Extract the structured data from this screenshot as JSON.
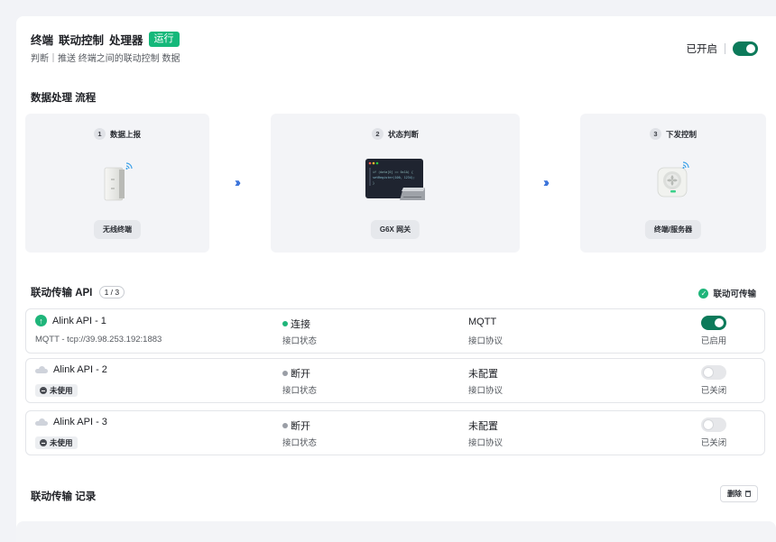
{
  "header": {
    "title_parts": [
      "终端",
      "联动控制",
      "处理器"
    ],
    "status_badge": "运行",
    "subtitle": "判断｜推送 终端之间的联动控制 数据",
    "toggle_label": "已开启",
    "enabled": true
  },
  "flow": {
    "title": "数据处理 流程",
    "steps": [
      {
        "num": "1",
        "label": "数据上报",
        "device": "无线终端",
        "icon": "wireless-terminal-icon"
      },
      {
        "num": "2",
        "label": "状态判断",
        "device": "G6X 网关",
        "icon": "gateway-code-icon"
      },
      {
        "num": "3",
        "label": "下发控制",
        "device": "终端/服务器",
        "icon": "fan-device-icon"
      }
    ],
    "screen_lines": [
      "if (data[0] == 0x1A) {",
      "  setRegister(100, 1234);",
      "}"
    ]
  },
  "api": {
    "title": "联动传输 API",
    "count": "1 / 3",
    "status": "联动可传输",
    "rows": [
      {
        "name": "Alink API - 1",
        "sub": "MQTT - tcp://39.98.253.192:1883",
        "state": "连接",
        "state_label": "接口状态",
        "protocol": "MQTT",
        "protocol_label": "接口协议",
        "enabled": true,
        "toggle_text": "已启用",
        "icon": "arrow-up-icon",
        "state_color": "#1fb57a"
      },
      {
        "name": "Alink API - 2",
        "sub": "未使用",
        "state": "断开",
        "state_label": "接口状态",
        "protocol": "未配置",
        "protocol_label": "接口协议",
        "enabled": false,
        "toggle_text": "已关闭",
        "icon": "cloud-icon",
        "state_color": "#9a9ea6"
      },
      {
        "name": "Alink API - 3",
        "sub": "未使用",
        "state": "断开",
        "state_label": "接口状态",
        "protocol": "未配置",
        "protocol_label": "接口协议",
        "enabled": false,
        "toggle_text": "已关闭",
        "icon": "cloud-icon",
        "state_color": "#9a9ea6"
      }
    ]
  },
  "log": {
    "title": "联动传输 记录",
    "delete_label": "删除"
  },
  "colors": {
    "accent_green": "#14b87a",
    "toggle_on": "#0c7a5a",
    "chevron_blue": "#2f6bd8"
  }
}
